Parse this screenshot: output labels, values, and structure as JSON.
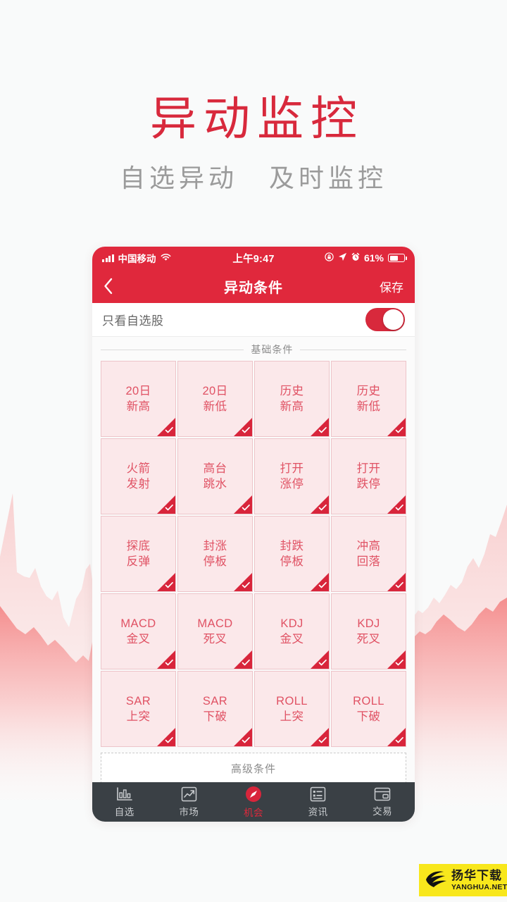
{
  "promo": {
    "title": "异动监控",
    "subtitle_left": "自选异动",
    "subtitle_right": "及时监控"
  },
  "statusbar": {
    "carrier": "中国移动",
    "wifi_icon": "wifi-icon",
    "signal_icon": "signal-bars-icon",
    "time": "上午9:47",
    "rotation_lock_icon": "rotation-lock-icon",
    "location_icon": "location-arrow-icon",
    "alarm_icon": "alarm-clock-icon",
    "battery_percent": "61%",
    "battery_icon": "battery-icon"
  },
  "navbar": {
    "back_icon": "chevron-left-icon",
    "title": "异动条件",
    "action_label": "保存"
  },
  "toggle_row": {
    "label": "只看自选股",
    "state": "on"
  },
  "sections": [
    {
      "header": "基础条件",
      "tiles": [
        {
          "line1": "20日",
          "line2": "新高",
          "checked": true
        },
        {
          "line1": "20日",
          "line2": "新低",
          "checked": true
        },
        {
          "line1": "历史",
          "line2": "新高",
          "checked": true
        },
        {
          "line1": "历史",
          "line2": "新低",
          "checked": true
        },
        {
          "line1": "火箭",
          "line2": "发射",
          "checked": true
        },
        {
          "line1": "高台",
          "line2": "跳水",
          "checked": true
        },
        {
          "line1": "打开",
          "line2": "涨停",
          "checked": true
        },
        {
          "line1": "打开",
          "line2": "跌停",
          "checked": true
        },
        {
          "line1": "探底",
          "line2": "反弹",
          "checked": true
        },
        {
          "line1": "封涨",
          "line2": "停板",
          "checked": true
        },
        {
          "line1": "封跌",
          "line2": "停板",
          "checked": true
        },
        {
          "line1": "冲高",
          "line2": "回落",
          "checked": true
        },
        {
          "line1": "MACD",
          "line2": "金叉",
          "checked": true
        },
        {
          "line1": "MACD",
          "line2": "死叉",
          "checked": true
        },
        {
          "line1": "KDJ",
          "line2": "金叉",
          "checked": true
        },
        {
          "line1": "KDJ",
          "line2": "死叉",
          "checked": true
        },
        {
          "line1": "SAR",
          "line2": "上突",
          "checked": true
        },
        {
          "line1": "SAR",
          "line2": "下破",
          "checked": true
        },
        {
          "line1": "ROLL",
          "line2": "上突",
          "checked": true
        },
        {
          "line1": "ROLL",
          "line2": "下破",
          "checked": true
        }
      ]
    }
  ],
  "advanced": {
    "header": "高级条件",
    "ghost_tile_count": 4
  },
  "tabbar": {
    "items": [
      {
        "label": "自选",
        "icon": "bar-chart-icon",
        "active": false
      },
      {
        "label": "市场",
        "icon": "trend-up-icon",
        "active": false
      },
      {
        "label": "机会",
        "icon": "compass-icon",
        "active": true
      },
      {
        "label": "资讯",
        "icon": "news-list-icon",
        "active": false
      },
      {
        "label": "交易",
        "icon": "card-icon",
        "active": false
      }
    ]
  },
  "watermark": {
    "cn": "扬华下载",
    "en": "YANGHUA.NET",
    "icon": "globe-icon"
  },
  "colors": {
    "brand_red": "#e0283c",
    "title_red": "#d8293c",
    "tile_bg": "#fbe8ea",
    "tile_border": "#edc4c9",
    "tile_text": "#e05264",
    "tabbar_bg": "#3a4045",
    "page_bg": "#f9fafa",
    "watermark_yellow": "#f8e71c"
  }
}
